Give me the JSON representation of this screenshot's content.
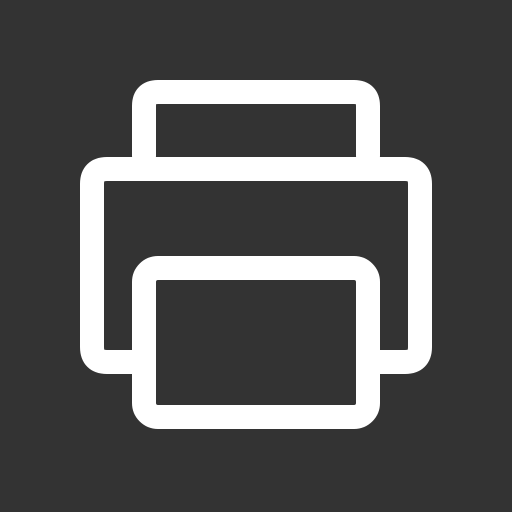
{
  "icon": {
    "name": "printer-icon",
    "background_color": "#333333",
    "stroke_color": "#FFFFFF"
  }
}
